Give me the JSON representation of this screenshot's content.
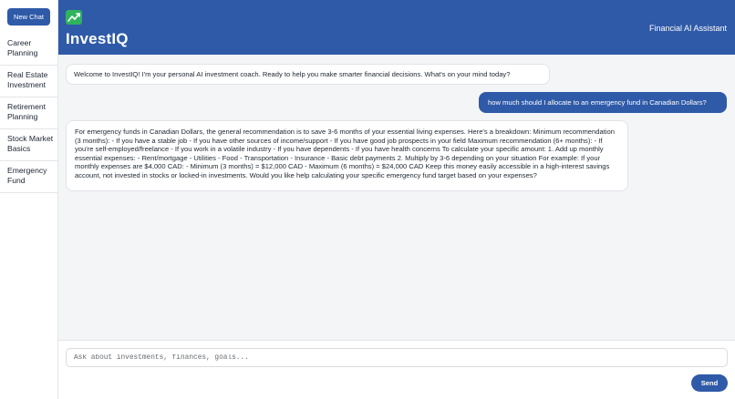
{
  "sidebar": {
    "new_chat_label": "New Chat",
    "items": [
      {
        "label": "Career Planning"
      },
      {
        "label": "Real Estate Investment"
      },
      {
        "label": "Retirement Planning"
      },
      {
        "label": "Stock Market Basics"
      },
      {
        "label": "Emergency Fund"
      }
    ]
  },
  "header": {
    "brand": "InvestIQ",
    "subtitle": "Financial AI Assistant",
    "logo_icon": "chart-trend-icon"
  },
  "messages": [
    {
      "role": "assistant",
      "text": "Welcome to InvestIQ! I'm your personal AI investment coach. Ready to help you make smarter financial decisions. What's on your mind today?"
    },
    {
      "role": "user",
      "text": "how much should I allocate to an emergency fund in Canadian Dollars?"
    },
    {
      "role": "assistant",
      "text": "For emergency funds in Canadian Dollars, the general recommendation is to save 3-6 months of your essential living expenses. Here's a breakdown: Minimum recommendation (3 months): - If you have a stable job - If you have other sources of income/support - If you have good job prospects in your field Maximum recommendation (6+ months): - If you're self-employed/freelance - If you work in a volatile industry - If you have dependents - If you have health concerns To calculate your specific amount: 1. Add up monthly essential expenses: - Rent/mortgage - Utilities - Food - Transportation - Insurance - Basic debt payments 2. Multiply by 3-6 depending on your situation For example: If your monthly expenses are $4,000 CAD: - Minimum (3 months) = $12,000 CAD - Maximum (6 months) = $24,000 CAD Keep this money easily accessible in a high-interest savings account, not invested in stocks or locked-in investments. Would you like help calculating your specific emergency fund target based on your expenses?"
    }
  ],
  "composer": {
    "placeholder": "Ask about investments, finances, goals...",
    "value": "",
    "send_label": "Send"
  },
  "colors": {
    "primary": "#2f5aa8",
    "logo": "#2fb35c",
    "background": "#f4f5f7"
  }
}
